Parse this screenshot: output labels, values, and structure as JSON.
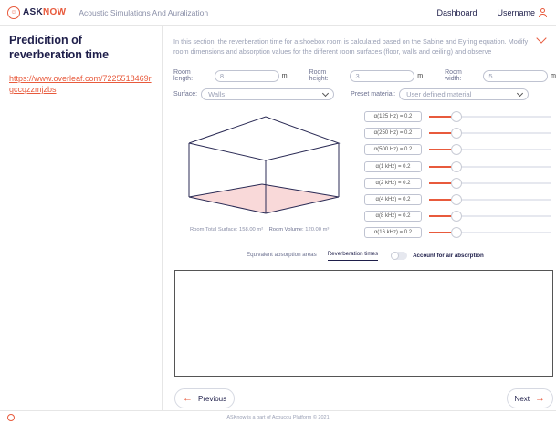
{
  "header": {
    "logo_text_a": "ASK",
    "logo_text_b": "NOW",
    "app_title": "Acoustic Simulations And Auralization",
    "dashboard_label": "Dashboard",
    "username_label": "Username"
  },
  "sidebar": {
    "title": "Predicition of reverberation time",
    "link": "https://www.overleaf.com/7225518469rgccqzzmjzbs"
  },
  "intro": {
    "text": "In this section, the reverberation time for a shoebox room is calculated based on the Sabine and Eyring equation. Modify room dimensions and absorption values for the different room surfaces (floor, walls and ceiling) and observe"
  },
  "dimensions": {
    "length_label": "Room length:",
    "length_value": "8",
    "height_label": "Room height:",
    "height_value": "3",
    "width_label": "Room width:",
    "width_value": "5",
    "unit": "m"
  },
  "surface": {
    "label": "Surface:",
    "value": "Walls",
    "preset_label": "Preset material:",
    "preset_value": "User defined material"
  },
  "absorption": [
    {
      "label": "α(125 Hz)  = 0.2",
      "level": 0.2
    },
    {
      "label": "α(250 Hz)  = 0.2",
      "level": 0.2
    },
    {
      "label": "α(500 Hz)  = 0.2",
      "level": 0.2
    },
    {
      "label": "α(1 kHz)  = 0.2",
      "level": 0.2
    },
    {
      "label": "α(2 kHz)  = 0.2",
      "level": 0.2
    },
    {
      "label": "α(4 kHz)  = 0.2",
      "level": 0.2
    },
    {
      "label": "α(8 kHz)  = 0.2",
      "level": 0.2
    },
    {
      "label": "α(16 kHz)  = 0.2",
      "level": 0.2
    }
  ],
  "room_info": {
    "surface_label": "Room Total Surface:",
    "surface_value": "158.00 m²",
    "volume_label": "Room Volume:",
    "volume_value": "120.00 m³"
  },
  "tabs": {
    "tab1": "Equivalent absorption areas",
    "tab2": "Reverberation times",
    "toggle_label": "Account for air absorption"
  },
  "buttons": {
    "previous": "Previous",
    "next": "Next"
  },
  "footer": {
    "text": "ASKnow is a part of Acoucou Platform © 2021"
  },
  "colors": {
    "accent": "#e85a3c",
    "navy": "#1e1e4a",
    "floor_fill": "#f9d9d9"
  }
}
